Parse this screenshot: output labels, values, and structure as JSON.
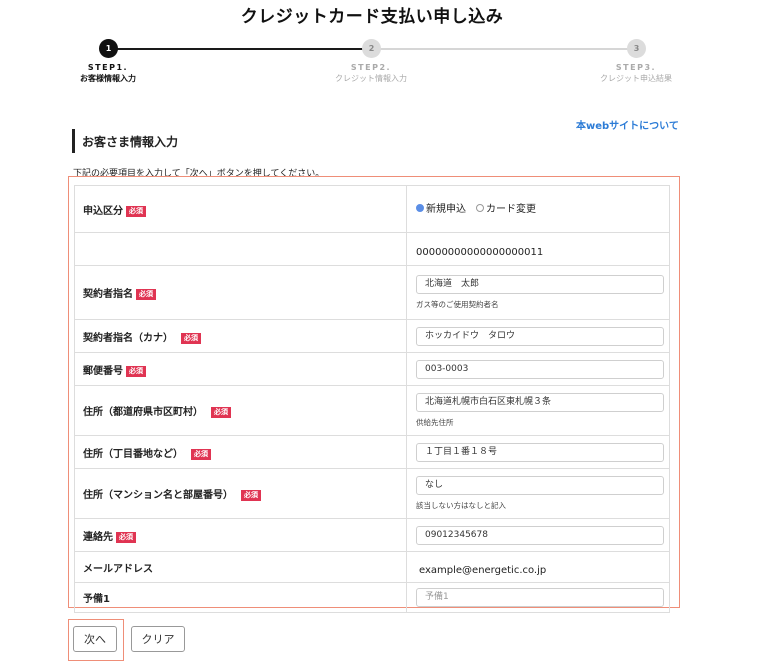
{
  "page": {
    "title": "クレジットカード支払い申し込み"
  },
  "stepper": {
    "steps": [
      {
        "num": "1",
        "code": "STEP1.",
        "label": "お客様情報入力",
        "state": "active"
      },
      {
        "num": "2",
        "code": "STEP2.",
        "label": "クレジット情報入力",
        "state": "inactive"
      },
      {
        "num": "3",
        "code": "STEP3.",
        "label": "クレジット申込結果",
        "state": "inactive"
      }
    ]
  },
  "links": {
    "about": "本webサイトについて"
  },
  "section": {
    "title": "お客さま情報入力",
    "instruction": "下記の必要項目を入力して「次へ」ボタンを押してください。"
  },
  "required_badge": "必須",
  "form": {
    "application_type": {
      "label": "申込区分",
      "options": [
        "新規申込",
        "カード変更"
      ],
      "selected": "新規申込"
    },
    "customer_number": {
      "value": "00000000000000000011"
    },
    "contract_name": {
      "label": "契約者指名",
      "value": "北海道　太郎",
      "hint": "ガス等のご使用契約者名"
    },
    "contract_name_kana": {
      "label": "契約者指名（カナ）",
      "value": "ホッカイドウ　タロウ"
    },
    "postal_code": {
      "label": "郵便番号",
      "value": "003-0003"
    },
    "address_city": {
      "label": "住所（都道府県市区町村）",
      "value": "北海道札幌市白石区東札幌３条",
      "hint": "供給先住所"
    },
    "address_block": {
      "label": "住所（丁目番地など）",
      "value": "１丁目１番１８号"
    },
    "address_building": {
      "label": "住所（マンション名と部屋番号）",
      "value": "なし",
      "hint": "該当しない方はなしと記入"
    },
    "phone": {
      "label": "連絡先",
      "value": "09012345678"
    },
    "email": {
      "label": "メールアドレス",
      "value": "example@energetic.co.jp"
    },
    "spare1": {
      "label": "予備1",
      "placeholder": "予備1"
    }
  },
  "buttons": {
    "next": "次へ",
    "clear": "クリア"
  },
  "colors": {
    "accent_link": "#2b7bd6",
    "required_badge": "#e03452",
    "highlight_frame": "#ef8e78",
    "active_step": "#111111"
  }
}
